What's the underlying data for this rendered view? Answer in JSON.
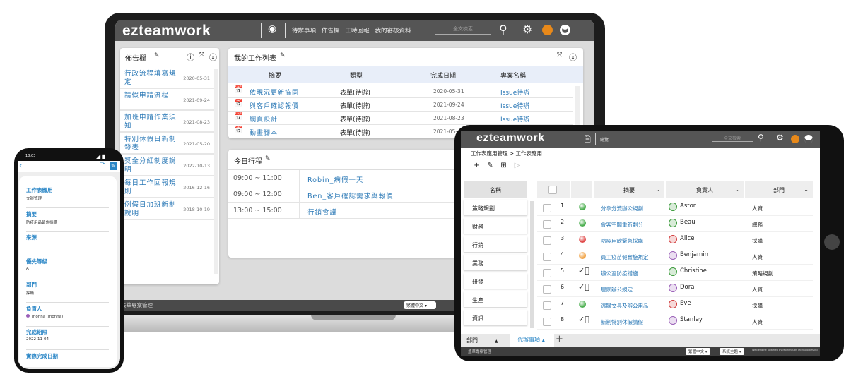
{
  "laptop": {
    "logo": "ezteamwork",
    "nav": [
      "待辦事項",
      "佈告欄",
      "工時回報",
      "我的審核資料"
    ],
    "search_placeholder": "全文檢索",
    "bulletin": {
      "title": "佈告欄",
      "items": [
        {
          "title": "行政流程填寫規定",
          "date": "2020-05-31"
        },
        {
          "title": "請假申請流程",
          "date": "2021-09-24"
        },
        {
          "title": "加班申請作業須知",
          "date": "2021-08-23"
        },
        {
          "title": "特別休假日新制發表",
          "date": "2021-05-20"
        },
        {
          "title": "獎金分紅制度說明",
          "date": "2022-10-13"
        },
        {
          "title": "每日工作回報規則",
          "date": "2016-12-16"
        },
        {
          "title": "例假日加班新制說明",
          "date": "2018-10-19"
        }
      ]
    },
    "worklist": {
      "title": "我的工作列表",
      "headers": [
        "摘要",
        "類型",
        "完成日期",
        "專案名稱"
      ],
      "rows": [
        {
          "summary": "依現況更新協同",
          "type": "表單(待辦)",
          "date": "2020-05-31",
          "project": "Issue待辦"
        },
        {
          "summary": "與客戶確認報價",
          "type": "表單(待辦)",
          "date": "2021-09-24",
          "project": "Issue待辦"
        },
        {
          "summary": "網頁設計",
          "type": "表單(待辦)",
          "date": "2021-08-23",
          "project": "Issue待辦"
        },
        {
          "summary": "動畫腳本",
          "type": "表單(待辦)",
          "date": "2021-05-",
          "project": ""
        }
      ]
    },
    "today": {
      "title": "今日行程",
      "rows": [
        {
          "time": "09:00 ~ 11:00",
          "event": "Robin_病假一天"
        },
        {
          "time": "09:00 ~ 12:00",
          "event": "Ben_客戶確認需求與報價"
        },
        {
          "time": "13:00 ~ 15:00",
          "event": "行銷會議"
        }
      ]
    },
    "footer": {
      "company": "去華專案管理",
      "language": "繁體中文"
    }
  },
  "phone": {
    "time": "18:03",
    "fields": [
      {
        "label": "工作表應用",
        "value": "交辦管理"
      },
      {
        "label": "摘要",
        "value": "防疫用品緊急採購"
      },
      {
        "label": "來源",
        "value": ""
      },
      {
        "label": "優先等級",
        "value": "A"
      },
      {
        "label": "部門",
        "value": "採購"
      },
      {
        "label": "負責人",
        "value": "monna (monna)"
      },
      {
        "label": "完成期限",
        "value": "2022-11-04"
      },
      {
        "label": "實際完成日期",
        "value": ""
      }
    ]
  },
  "tablet": {
    "logo": "ezteamwork",
    "nav": "總覽",
    "search_placeholder": "全文檢索",
    "breadcrumb": "工作表應用管理 > 工作表應用",
    "left_header": "名稱",
    "categories": [
      "策略規劃",
      "財務",
      "行銷",
      "業務",
      "研發",
      "生產",
      "資訊"
    ],
    "headers": [
      "摘要",
      "負責人",
      "部門"
    ],
    "rows": [
      {
        "no": "1",
        "status": "green",
        "summary": "分拿分流辦公規劃",
        "owner": "Astor",
        "owner_color": "#3a9a3a",
        "dept": "人資"
      },
      {
        "no": "2",
        "status": "green",
        "summary": "會客空間重新劃分",
        "owner": "Beau",
        "owner_color": "#3a9a3a",
        "dept": "總務"
      },
      {
        "no": "3",
        "status": "red",
        "summary": "防疫用飲緊急採購",
        "owner": "Alice",
        "owner_color": "#d23b3b",
        "dept": "採購"
      },
      {
        "no": "4",
        "status": "orange",
        "summary": "員工疫苗假實施規定",
        "owner": "Benjamin",
        "owner_color": "#9a5fb8",
        "dept": "人資"
      },
      {
        "no": "5",
        "status": "done",
        "summary": "辦公室防疫措施",
        "owner": "Christine",
        "owner_color": "#3a9a3a",
        "dept": "策略規劃"
      },
      {
        "no": "6",
        "status": "done",
        "summary": "居家辦公規定",
        "owner": "Dora",
        "owner_color": "#9a5fb8",
        "dept": "人資"
      },
      {
        "no": "7",
        "status": "green",
        "summary": "添購文具及辦公用品",
        "owner": "Eve",
        "owner_color": "#d23b3b",
        "dept": "採購"
      },
      {
        "no": "8",
        "status": "done",
        "summary": "新制特別休假請假",
        "owner": "Stanley",
        "owner_color": "#9a5fb8",
        "dept": "人資"
      }
    ],
    "tabs": [
      "部門",
      "代辦事項"
    ],
    "footer": {
      "company": "孟華專案管理",
      "language": "繁體中文",
      "theme": "系統主題",
      "powered": "Web engine powered by Mommouth Technologies Inc."
    }
  },
  "colors": {
    "header": "#555555",
    "link": "#2a78b6",
    "green": "#4caf50",
    "red": "#e04848",
    "orange": "#f0a040",
    "accent_orange": "#e8891a"
  }
}
